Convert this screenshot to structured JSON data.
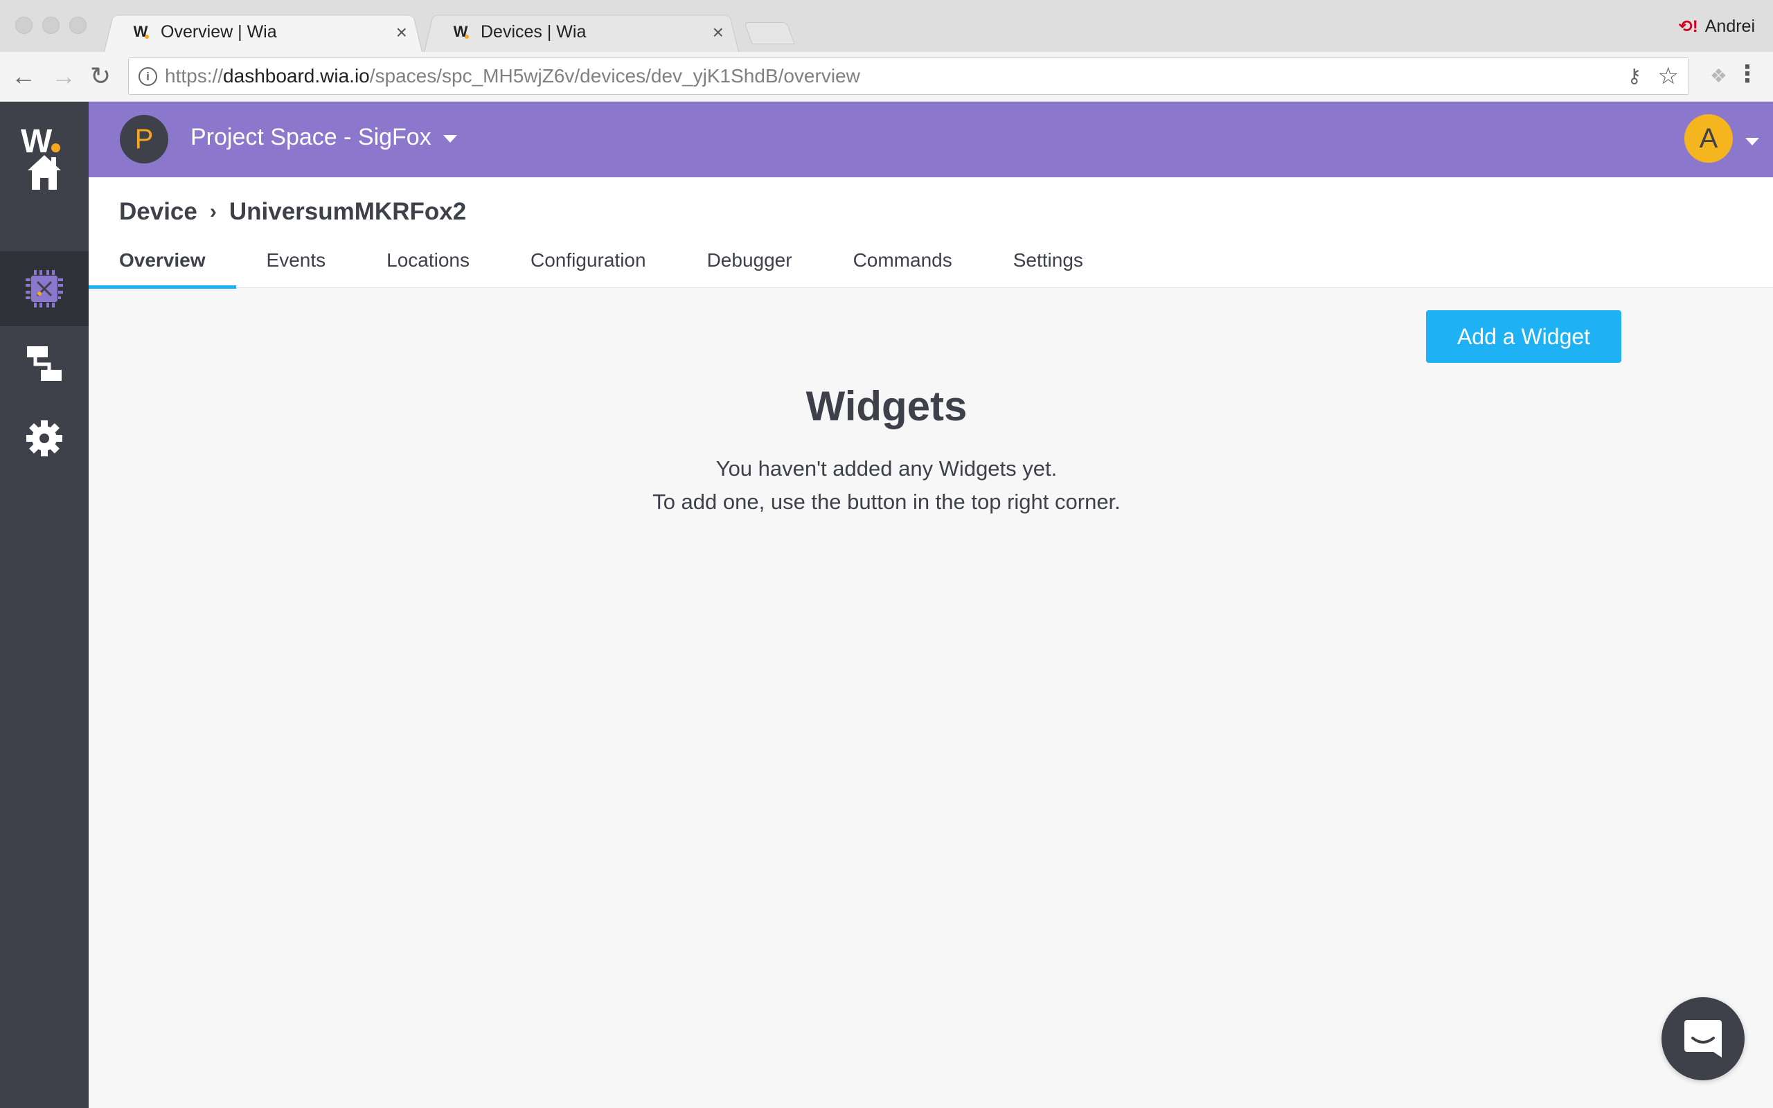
{
  "browser": {
    "tabs": [
      {
        "favicon": "W",
        "title": "Overview | Wia",
        "close": "×"
      },
      {
        "favicon": "W",
        "title": "Devices | Wia",
        "close": "×"
      }
    ],
    "profile_name": "Andrei",
    "url_scheme": "https://",
    "url_host": "dashboard.wia.io",
    "url_path": "/spaces/spc_MH5wjZ6v/devices/dev_yjK1ShdB/overview",
    "icons": [
      "back-arrow-icon",
      "forward-arrow-icon",
      "reload-icon",
      "info-icon",
      "key-icon",
      "star-icon",
      "dropbox-icon",
      "menu-dots-icon",
      "sync-error-icon"
    ]
  },
  "sidebar": {
    "logo": "W",
    "items": [
      {
        "icon": "home-icon"
      },
      {
        "icon": "device-chip-icon",
        "active": true
      },
      {
        "icon": "flow-icon"
      },
      {
        "icon": "gear-icon"
      }
    ]
  },
  "topbar": {
    "space_avatar": "P",
    "space_name": "Project Space - SigFox",
    "user_avatar": "A",
    "bg_color": "#8b78cd",
    "accent_color": "#f5a623"
  },
  "header": {
    "crumb_root": "Device",
    "crumb_sep": "›",
    "device_name": "UniversumMKRFox2",
    "tabs": [
      {
        "label": "Overview",
        "active": true
      },
      {
        "label": "Events"
      },
      {
        "label": "Locations"
      },
      {
        "label": "Configuration"
      },
      {
        "label": "Debugger"
      },
      {
        "label": "Commands"
      },
      {
        "label": "Settings"
      }
    ],
    "tab_active_color": "#1eb2f5"
  },
  "main": {
    "add_widget_label": "Add a Widget",
    "title": "Widgets",
    "line1": "You haven't added any Widgets yet.",
    "line2": "To add one, use the button in the top right corner."
  },
  "chat": {
    "icon": "chat-bubble-icon"
  }
}
